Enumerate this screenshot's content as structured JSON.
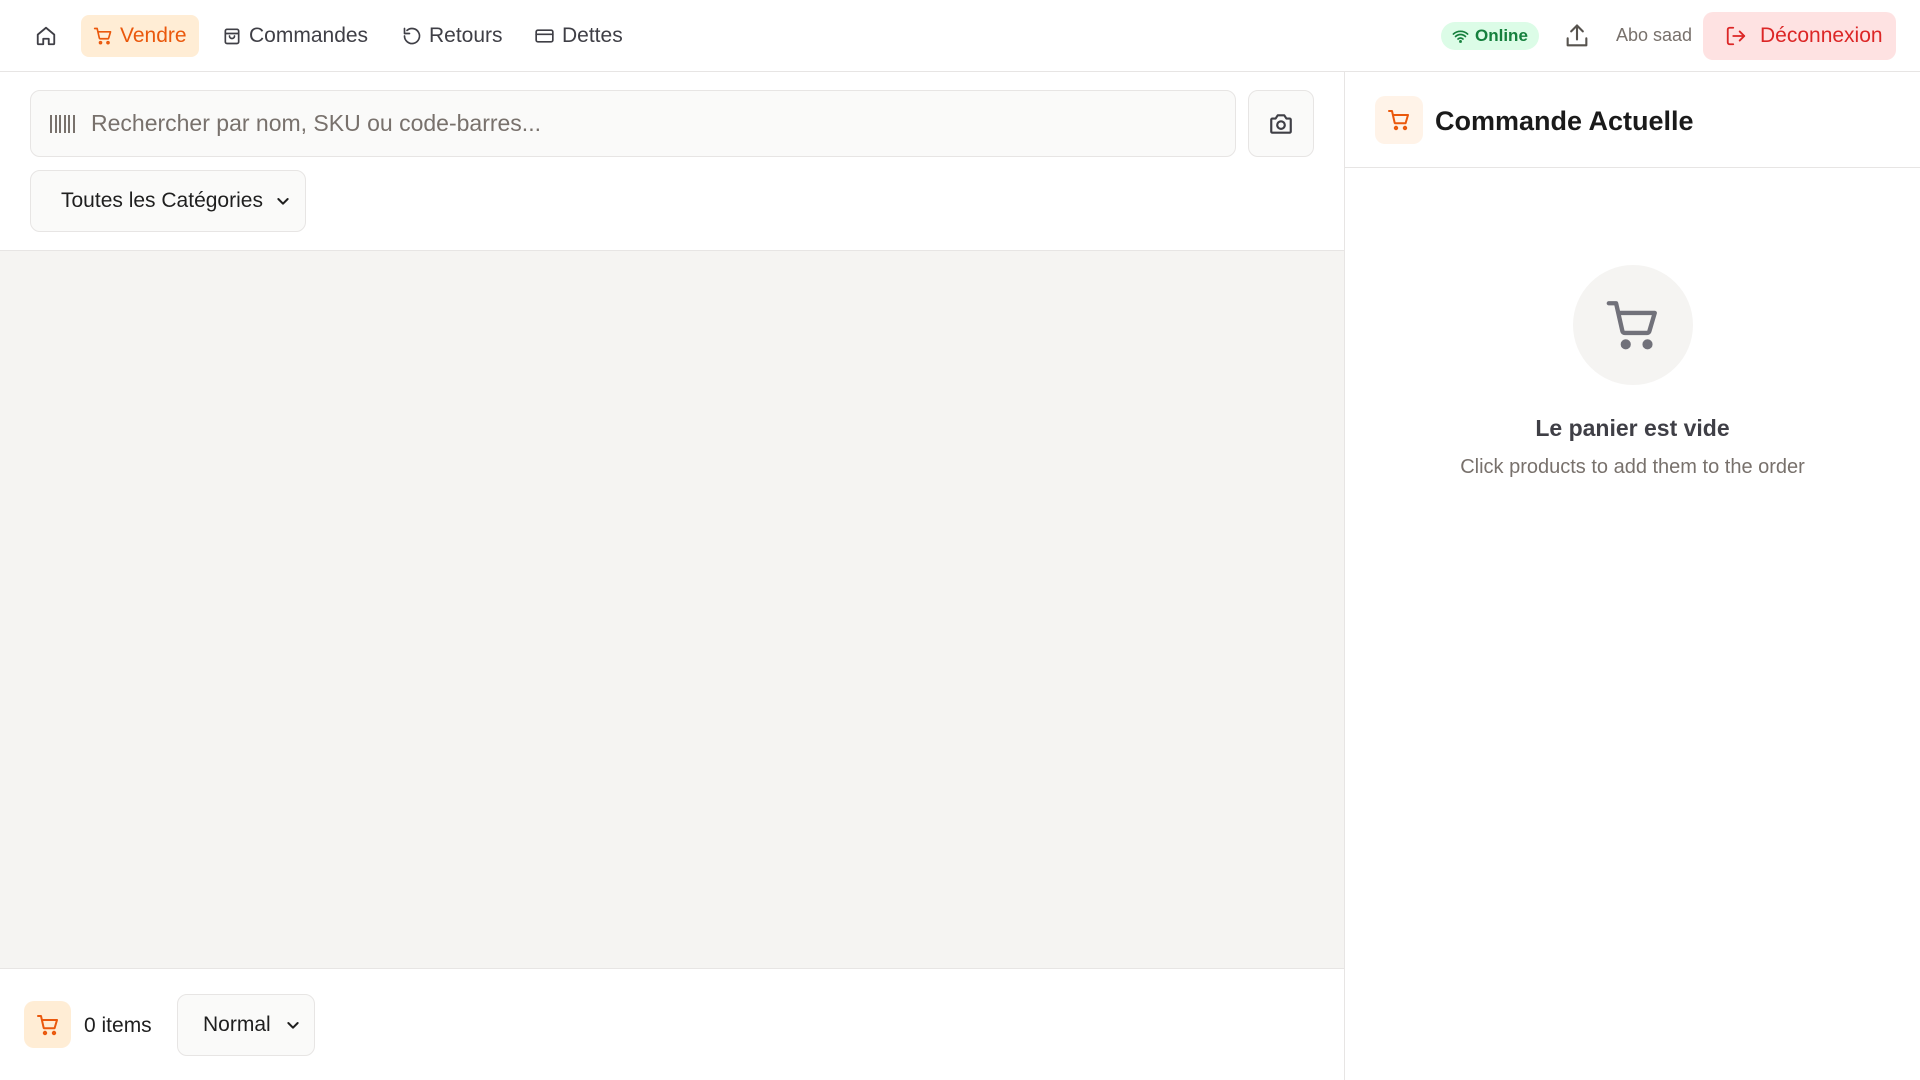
{
  "nav": {
    "items": [
      {
        "label": "Vendre",
        "icon": "cart-icon",
        "active": true
      },
      {
        "label": "Commandes",
        "icon": "bag-icon",
        "active": false
      },
      {
        "label": "Retours",
        "icon": "undo-icon",
        "active": false
      },
      {
        "label": "Dettes",
        "icon": "card-icon",
        "active": false
      }
    ],
    "status": "Online",
    "user": "Abo saad",
    "logout_label": "Déconnexion"
  },
  "search": {
    "placeholder": "Rechercher par nom, SKU ou code-barres..."
  },
  "filters": {
    "category": "Toutes les Catégories"
  },
  "bottom": {
    "count_label": "0 items",
    "price_mode": "Normal"
  },
  "order": {
    "title": "Commande Actuelle",
    "empty_title": "Le panier est vide",
    "empty_subtitle": "Click products to add them to the order"
  },
  "colors": {
    "accent": "#ea580c",
    "accent_bg": "#ffedd5",
    "online": "#15803d",
    "logout": "#dc2626"
  }
}
